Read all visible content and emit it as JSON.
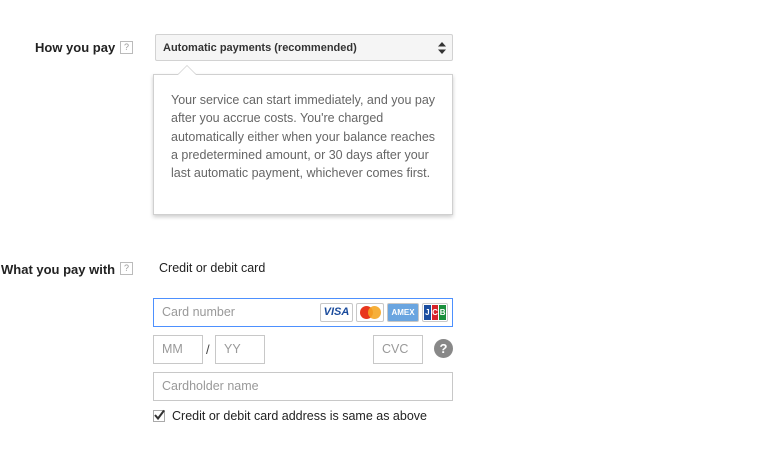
{
  "how_you_pay": {
    "label": "How you pay",
    "help": "?",
    "selected": "Automatic payments (recommended)",
    "description": "Your service can start immediately, and you pay after you accrue costs. You're charged automatically either when your balance reaches a predetermined amount, or 30 days after your last automatic payment, whichever comes first."
  },
  "what_you_pay_with": {
    "label": "What you pay with",
    "help": "?",
    "method": "Credit or debit card"
  },
  "card_form": {
    "card_number_placeholder": "Card number",
    "card_logos": [
      "VISA",
      "MasterCard",
      "AMEX",
      "JCB"
    ],
    "month_placeholder": "MM",
    "separator": "/",
    "year_placeholder": "YY",
    "cvc_placeholder": "CVC",
    "cvc_help": "?",
    "cardholder_placeholder": "Cardholder name",
    "same_address_label": "Credit or debit card address is same as above",
    "same_address_checked": true
  },
  "colors": {
    "focus_border": "#4d90fe",
    "visa_blue": "#1a4b9c",
    "amex_blue": "#6aa5e0"
  }
}
